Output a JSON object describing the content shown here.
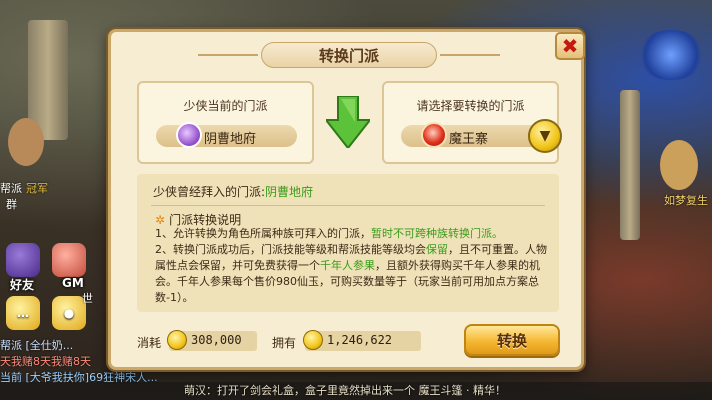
{
  "dialog": {
    "title": "转换门派",
    "current_label": "少侠当前的门派",
    "current_sect": "阴曹地府",
    "select_label": "请选择要转换的门派",
    "selected_sect": "魔王寨",
    "former_label": "少侠曾经拜入的门派:",
    "former_value": "阴曹地府",
    "help_title": "门派转换说明",
    "help": {
      "p1_a": "1、允许转换为角色所属种族可拜入的门派，",
      "p1_b": "暂时不可跨种族转换门派。",
      "p2_a": "2、转换门派成功后，门派技能等级和帮派技能等级均会",
      "p2_b": "保留",
      "p2_c": "，且不可重置。人物属性点会保留，并可免费获得一个",
      "p2_d": "千年人参果",
      "p2_e": "，且额外获得购买千年人参果的机会。千年人参果每个售价980仙玉，可购买数量等于（玩家当前可用加点方案总数-1）。"
    },
    "cost_label": "消耗",
    "cost_value": "308,000",
    "own_label": "拥有",
    "own_value": "1,246,622",
    "confirm_label": "转换"
  },
  "background": {
    "left_side_1": "帮派",
    "left_side_2": "冠军",
    "left_side_3": "群",
    "friends_label": "好友",
    "gm_label": "GM",
    "world_tag": "世",
    "chat_line_1": "帮派 [全仕奶...",
    "chat_line_2": "天我赌8天我赌8天",
    "chat_line_3": "当前 [大爷我扶你]69狂神宋人...",
    "right_tag": "如梦复生",
    "bottom_message": "萌汉：打开了剑会礼盒，盒子里竟然掉出来一个 魔王斗篷 · 精华！"
  },
  "colors": {
    "accent_green": "#3a9c1a",
    "close_red": "#c4190f",
    "button_gold": "#f5b733"
  },
  "icons": {
    "current_sect_icon": "ghost-sect-icon",
    "selected_sect_icon": "demon-sect-icon",
    "dropdown": "chevron-down-icon",
    "close": "close-icon",
    "coin": "coin-icon",
    "arrow": "arrow-right-icon"
  }
}
